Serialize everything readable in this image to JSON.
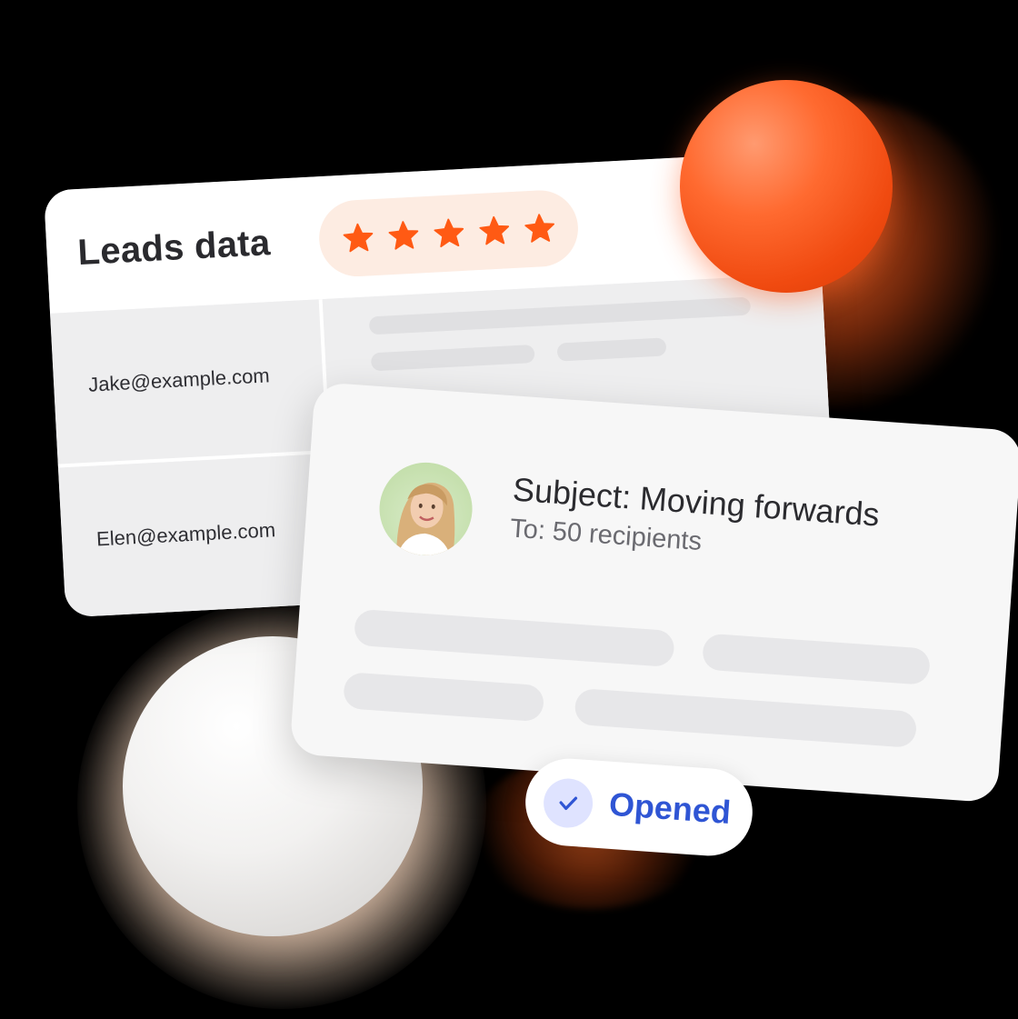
{
  "leads_card": {
    "title": "Leads data",
    "rating_stars": 5,
    "rows": [
      {
        "email": "Jake@example.com"
      },
      {
        "email": "Elen@example.com"
      }
    ]
  },
  "email_card": {
    "subject": "Subject: Moving forwards",
    "recipients": "To: 50 recipients",
    "avatar_icon": "person-avatar-icon"
  },
  "status_badge": {
    "label": "Opened",
    "icon": "checkmark-icon"
  },
  "colors": {
    "accent_orange": "#ff5a14",
    "star_color": "#ff5a14",
    "opened_blue": "#2f55d4",
    "check_bg": "#dfe3ff",
    "avatar_bg": "#bedba3"
  }
}
